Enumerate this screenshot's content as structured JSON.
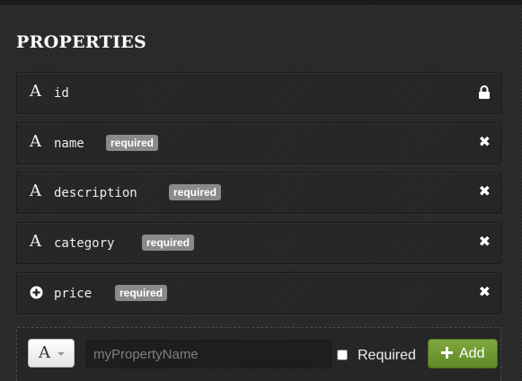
{
  "title": "PROPERTIES",
  "properties": [
    {
      "type_icon": "A",
      "icon_name": "text-type-icon",
      "name": "id",
      "badge": "",
      "action_icon": "lock-icon"
    },
    {
      "type_icon": "A",
      "icon_name": "text-type-icon",
      "name": "name",
      "badge": "required",
      "action_icon": "close-icon"
    },
    {
      "type_icon": "A",
      "icon_name": "text-type-icon",
      "name": "description",
      "badge": "required",
      "action_icon": "close-icon"
    },
    {
      "type_icon": "A",
      "icon_name": "text-type-icon",
      "name": "category",
      "badge": "required",
      "action_icon": "close-icon"
    },
    {
      "type_icon": "",
      "icon_name": "plus-circle-type-icon",
      "name": "price",
      "badge": "required",
      "action_icon": "close-icon"
    }
  ],
  "close_glyph": "✖",
  "add_form": {
    "type_select_value": "A",
    "name_placeholder": "myPropertyName",
    "name_value": "",
    "required_label": "Required",
    "required_checked": false,
    "add_label": "Add"
  },
  "colors": {
    "badge": "#8a8a8a",
    "add_button": "#6f9b31",
    "background": "#2b2b2b"
  }
}
